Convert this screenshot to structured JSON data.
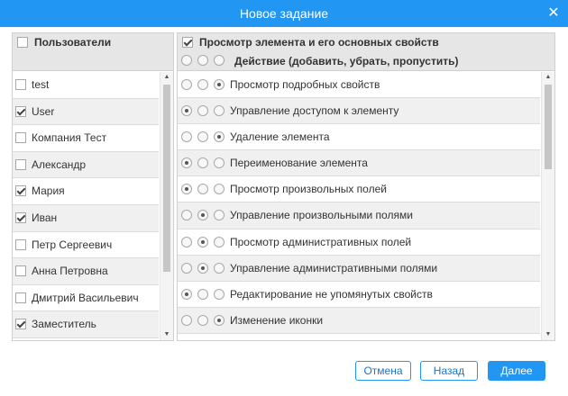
{
  "dialog": {
    "title": "Новое задание",
    "close_glyph": "✕"
  },
  "users": {
    "header_label": "Пользователи",
    "header_checked": false,
    "items": [
      {
        "label": "test",
        "checked": false
      },
      {
        "label": "User",
        "checked": true
      },
      {
        "label": "Компания Тест",
        "checked": false
      },
      {
        "label": "Александр",
        "checked": false
      },
      {
        "label": "Мария",
        "checked": true
      },
      {
        "label": "Иван",
        "checked": true
      },
      {
        "label": "Петр Сергеевич",
        "checked": false
      },
      {
        "label": "Анна Петровна",
        "checked": false
      },
      {
        "label": "Дмитрий Васильевич",
        "checked": false
      },
      {
        "label": "Заместитель",
        "checked": true
      }
    ]
  },
  "permissions": {
    "header_label": "Просмотр элемента и его основных свойств",
    "header_checked": true,
    "action_label": "Действие (добавить, убрать, пропустить)",
    "items": [
      {
        "label": "Просмотр подробных свойств",
        "selected": 2
      },
      {
        "label": "Управление доступом к элементу",
        "selected": 0
      },
      {
        "label": "Удаление элемента",
        "selected": 2
      },
      {
        "label": "Переименование элемента",
        "selected": 0
      },
      {
        "label": "Просмотр произвольных полей",
        "selected": 0
      },
      {
        "label": "Управление произвольными полями",
        "selected": 1
      },
      {
        "label": "Просмотр административных полей",
        "selected": 1
      },
      {
        "label": "Управление административными полями",
        "selected": 1
      },
      {
        "label": "Редактирование не упомянутых свойств",
        "selected": 0
      },
      {
        "label": "Изменение иконки",
        "selected": 2
      },
      {
        "label": "",
        "selected": 0
      }
    ]
  },
  "buttons": {
    "cancel": "Отмена",
    "back": "Назад",
    "next": "Далее"
  },
  "colors": {
    "accent": "#2196f3",
    "link": "#1e73c8"
  }
}
